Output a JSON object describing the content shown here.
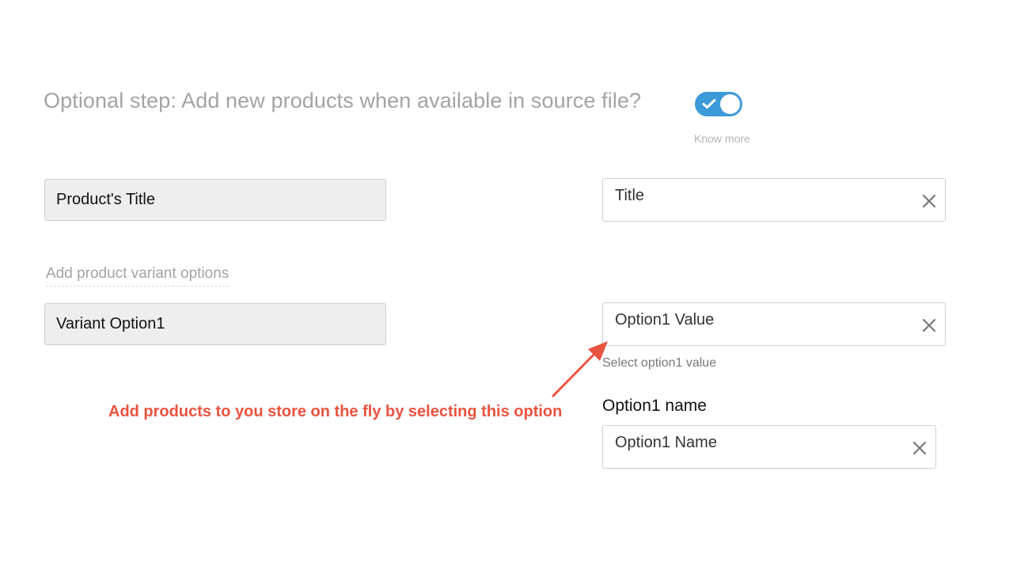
{
  "step": {
    "heading": "Optional step: Add new products when available in source file?",
    "toggle_on": true,
    "toggle_color": "#3d9ad9",
    "know_more_label": "Know more"
  },
  "mappings": {
    "title": {
      "source_label": "Product's Title",
      "target_value": "Title",
      "clear_icon": "close-icon"
    },
    "variant_link": "Add product variant options",
    "variant": {
      "source_label": "Variant Option1",
      "target_value": "Option1 Value",
      "helper": "Select option1 value",
      "clear_icon": "close-icon"
    },
    "option_name": {
      "label": "Option1 name",
      "target_value": "Option1 Name",
      "clear_icon": "close-icon"
    }
  },
  "annotation": {
    "text": "Add products to you store on the fly by selecting this option",
    "color": "#e9533f"
  }
}
